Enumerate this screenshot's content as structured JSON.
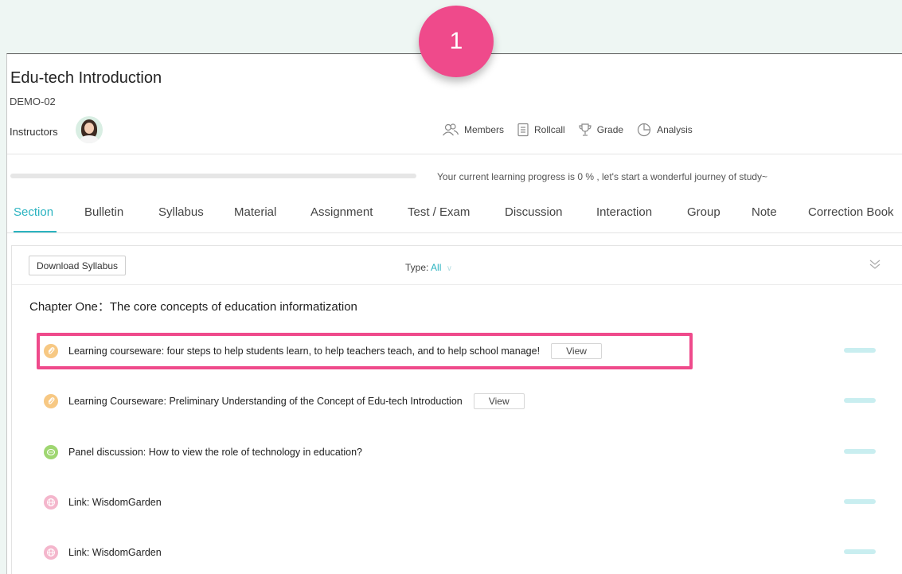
{
  "step": {
    "number": "1"
  },
  "course": {
    "title": "Edu-tech Introduction",
    "code": "DEMO-02",
    "instructors_label": "Instructors"
  },
  "toolbar": {
    "members": "Members",
    "rollcall": "Rollcall",
    "grade": "Grade",
    "analysis": "Analysis"
  },
  "progress": {
    "percent": 0,
    "text": "Your current learning progress is 0 % , let's start a wonderful journey of study~"
  },
  "tabs": [
    {
      "label": "Section",
      "active": true
    },
    {
      "label": "Bulletin"
    },
    {
      "label": "Syllabus"
    },
    {
      "label": "Material"
    },
    {
      "label": "Assignment"
    },
    {
      "label": "Test / Exam"
    },
    {
      "label": "Discussion"
    },
    {
      "label": "Interaction"
    },
    {
      "label": "Group"
    },
    {
      "label": "Note"
    },
    {
      "label": "Correction Book"
    }
  ],
  "section": {
    "download_label": "Download Syllabus",
    "type_label": "Type:",
    "type_value": "All",
    "chapter_title": "Chapter One：The core concepts of education informatization",
    "items": [
      {
        "icon": "courseware-icon",
        "icon_color": "#f7c883",
        "text": "Learning courseware: four steps to help students learn, to help teachers teach, and to help school manage!",
        "view_label": "View"
      },
      {
        "icon": "courseware-icon",
        "icon_color": "#f7c883",
        "text": "Learning Courseware: Preliminary Understanding of the Concept of Edu-tech Introduction",
        "view_label": "View"
      },
      {
        "icon": "discussion-icon",
        "icon_color": "#9fd671",
        "text": "Panel discussion: How to view the role of technology in education?"
      },
      {
        "icon": "link-icon",
        "icon_color": "#f4b6cc",
        "text": "Link: WisdomGarden"
      },
      {
        "icon": "link-icon",
        "icon_color": "#f4b6cc",
        "text": "Link: WisdomGarden"
      }
    ]
  },
  "colors": {
    "accent": "#2bb3c0",
    "highlight": "#ef4a8b",
    "background": "#eef6f3"
  }
}
